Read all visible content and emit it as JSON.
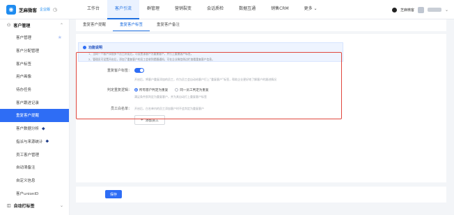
{
  "brand": {
    "name": "芝麻微客",
    "tag": "企业版",
    "clock_icon": "clock-icon",
    "logo_icon": "chat-bubble-icon"
  },
  "topnav": {
    "tabs": [
      "工作台",
      "客户引流",
      "群管理",
      "营销裂变",
      "会话质检",
      "数据互通",
      "销售CRM",
      "更多 ⌄"
    ],
    "active_index": 1
  },
  "user": {
    "name": "芝麻微客",
    "caret": "⌄"
  },
  "sidebar": {
    "group1": "客户管理",
    "items": [
      "客户管理",
      "客户分配管理",
      "客户标签",
      "用户画像",
      "待办任务",
      "客户跟进记录",
      "重复客户提醒",
      "客户数据分析",
      "指派与来源统计",
      "员工客户管理",
      "自动清备注",
      "自定义信息",
      "客户unionID"
    ],
    "active_index": 6,
    "group2": "自动打标签"
  },
  "subtabs": {
    "tabs": [
      "重复客户提醒",
      "重复客户标签",
      "重复客户备注"
    ],
    "active_index": 1
  },
  "notice": {
    "title": "功能说明",
    "line1": "1、当同一个客户添加多个员工好友后，可设置该客户为重复客户，并打上重复客户标签。",
    "line2": "2、管理员可设置开启后，添加了重复客户的员工会收到提醒通知，可在企业微信侧边栏查看重复客户信息。"
  },
  "form": {
    "repeat_label": "重复客户标签：",
    "repeat_hint": "开启后，将客户重复添加的员工，作为员工会自动给客户打上“重复客户”标签，帮助企业更好地了解客户的跟进情况",
    "logic_label": "判定重复逻辑：",
    "logic_options": [
      "所有客户判定为重复",
      "同一员工判定为重复"
    ],
    "logic_hint": "满足条件即判定为重复客户，并为其自动打上重复客户标签",
    "whitelist_label": "员工白名单：",
    "whitelist_hint": "开启后，白名单内的员工添加客户时不会判定为重复客户",
    "add_button": "添加员工"
  },
  "footer": {
    "save": "保存"
  },
  "colors": {
    "accent": "#2e6df5",
    "highlight_border": "#e0463c"
  }
}
